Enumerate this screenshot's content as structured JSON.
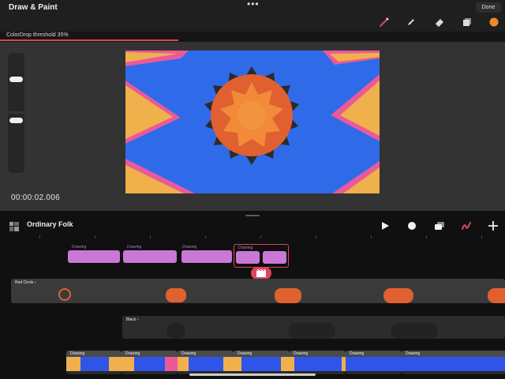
{
  "app": {
    "title": "Draw & Paint",
    "more": "•••",
    "done_label": "Done"
  },
  "toolbar": {
    "tools": [
      "brush-icon",
      "smudge-icon",
      "eraser-icon",
      "layers-icon",
      "color-swatch"
    ],
    "accent": "#e0445a",
    "current_color": "#f08a2c"
  },
  "threshold": {
    "label": "ColorDrop threshold 35%",
    "value_percent": 35
  },
  "canvas": {
    "timecode": "00:00:02.006"
  },
  "timeline": {
    "project_name": "Ordinary Folk",
    "controls": [
      "play-icon",
      "record-icon",
      "onion-skin-icon",
      "draw-mode-icon",
      "add-icon"
    ],
    "tracks": {
      "drawing_top": {
        "clip_label": "Drawing",
        "count": 5
      },
      "red_circle": {
        "title": "Red Circle"
      },
      "black": {
        "title": "Black"
      },
      "drawing_bottom": {
        "clip_label": "Drawing",
        "count": 8
      }
    }
  }
}
